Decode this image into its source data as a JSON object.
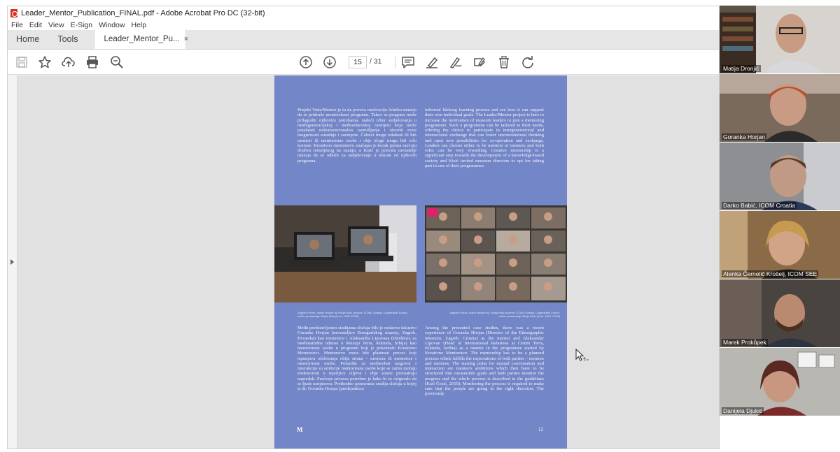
{
  "window": {
    "title": "Leader_Mentor_Publication_FINAL.pdf - Adobe Acrobat Pro DC (32-bit)",
    "menu": [
      "File",
      "Edit",
      "View",
      "E-Sign",
      "Window",
      "Help"
    ]
  },
  "tabs": {
    "home": "Home",
    "tools": "Tools",
    "document": "Leader_Mentor_Pu...",
    "close": "×"
  },
  "toolbar": {
    "icons": [
      "save-icon",
      "star-icon",
      "upload-icon",
      "print-icon",
      "zoom-search-icon",
      "page-up-icon",
      "page-down-icon",
      "comment-icon",
      "highlight-icon",
      "sign-icon",
      "edit-icon",
      "delete-icon",
      "rotate-icon"
    ],
    "current_page": "15",
    "page_total": "/ 31"
  },
  "document": {
    "background_color": "#7386c7",
    "top_left_text": "Projekt Voda/Mentor je tu da poveća motivaciju čelnika muzeja da se pridruže mentorskom programu. Takav se program može prilagoditi njihovim potrebama, nudeći izbor sudjelovanja u međugeneracijskoj i međusektorskoj razmjeni koja može potaknuti nekonvencionalno razmišljanje i otvoriti nove mogućnosti suradnje i razmjene. Čelnici mogu odabrati ili biti mentori ili mentorirane osobe i obje uloge mogu biti vrlo korisne. Kreativno mentorstvo značajan je korak prema razvoju društva temeljenog na znanju, a Kisić je pozvala ravnatelje muzeja da se odluče za sudjelovanje u nekom od njihovih programa.",
    "top_right_text": "informal lifelong learning process and see how it can support their own individual goals. The Leader/Mentor project is here to increase the motivation of museum leaders to join a mentoring programme. Such a programme can be tailored to their needs, offering the choice to participate in intergenerational and intersectoral exchange that can foster unconventional thinking and open new possibilities for co-operation and exchange. Leaders can choose either to be mentors or mentees and both roles can be very rewarding. Creative mentorship is a significant step towards the development of a knowledge-based society and Kisić invited museum directors to opt for taking part in one of their programmes.",
    "caption_left": "Zagreb Forum, online lecture by Višnja Kisić (source: ICOM Croatia) / Zagrebački Forum, online predavanje Višnje Kisić (izvor: HNK ICOM)",
    "caption_right": "Zagreb Forum, online lecture by Višnja Kisić (source: ICOM Croatia) / Zagrebački Forum, online predavanje Višnje Kisić (izvor: HNK ICOM)",
    "bottom_left_text": "Među predstavljenim studijama slučaja bilo je nedavno iskustvo Goranke Horjan (ravnateljice Etnografskog muzeja, Zagreb, Hrvatska) kao mentorice i Aleksandra Lipovana (Direktora za međunarodne odnose u Muzeju Terra, Kikinda, Srbija) kao mentorirane osobe u programu koji je pokrenulo Kreativno Mentorstvo. Mentorstvo mora biti planirani proces koji ispunjava očekivanja obiju strana – mentora ili mentorice i mentorirane osobe. Polazište za međusobni razgovor i interakciju su ambicije mentorirane osobe koje se zatim moraju strukturirati u mjerljive ciljeve i obje strane promatraju napredak. Praćenje procesa potrebno je kako bi se osiguralo da se ljude usmjerava. Prethodno spomenuta studija slučaja u kojoj je dr. Goranka Horjan (predsjednica",
    "bottom_right_text": "Among the presented case studies, there was a recent experience of Goranka Horjan (Director of the Ethnographic Museum, Zagreb, Croatia) as the mentor and Aleksandar Lipovan (Head of International Relations at Centre Terra, Kikinda, Serbia) as a mentee in the programme started by Kreativno Mentorstvo. The mentorship has to be a planned process which fulfills the expectations of both parties – mentors and mentees. The starting point for mutual conversation and interaction are mentee's ambitions which then have to be structured into measurable goals and both parties monitor the progress and the whole process is described in the guidelines (Karl Ćosić, 2019). Monitoring the process is required to make sure that the people are going in the right direction. The previously",
    "logo": "M",
    "page_number": "12"
  },
  "participants": [
    {
      "name": "Matija Dronjić",
      "bg": "#5b5147"
    },
    {
      "name": "Goranka Horjan",
      "bg": "#7a6a5c"
    },
    {
      "name": "Darko Babić, ICOM Croatia",
      "bg": "#8e8f92"
    },
    {
      "name": "Alenka Černelič Krošelj, ICOM SEE",
      "bg": "#8b6a48"
    },
    {
      "name": "Marek Prokůpek",
      "bg": "#4a4440"
    },
    {
      "name": "Danijela Djukić",
      "bg": "#b9b7b2"
    }
  ],
  "watermark": "M"
}
